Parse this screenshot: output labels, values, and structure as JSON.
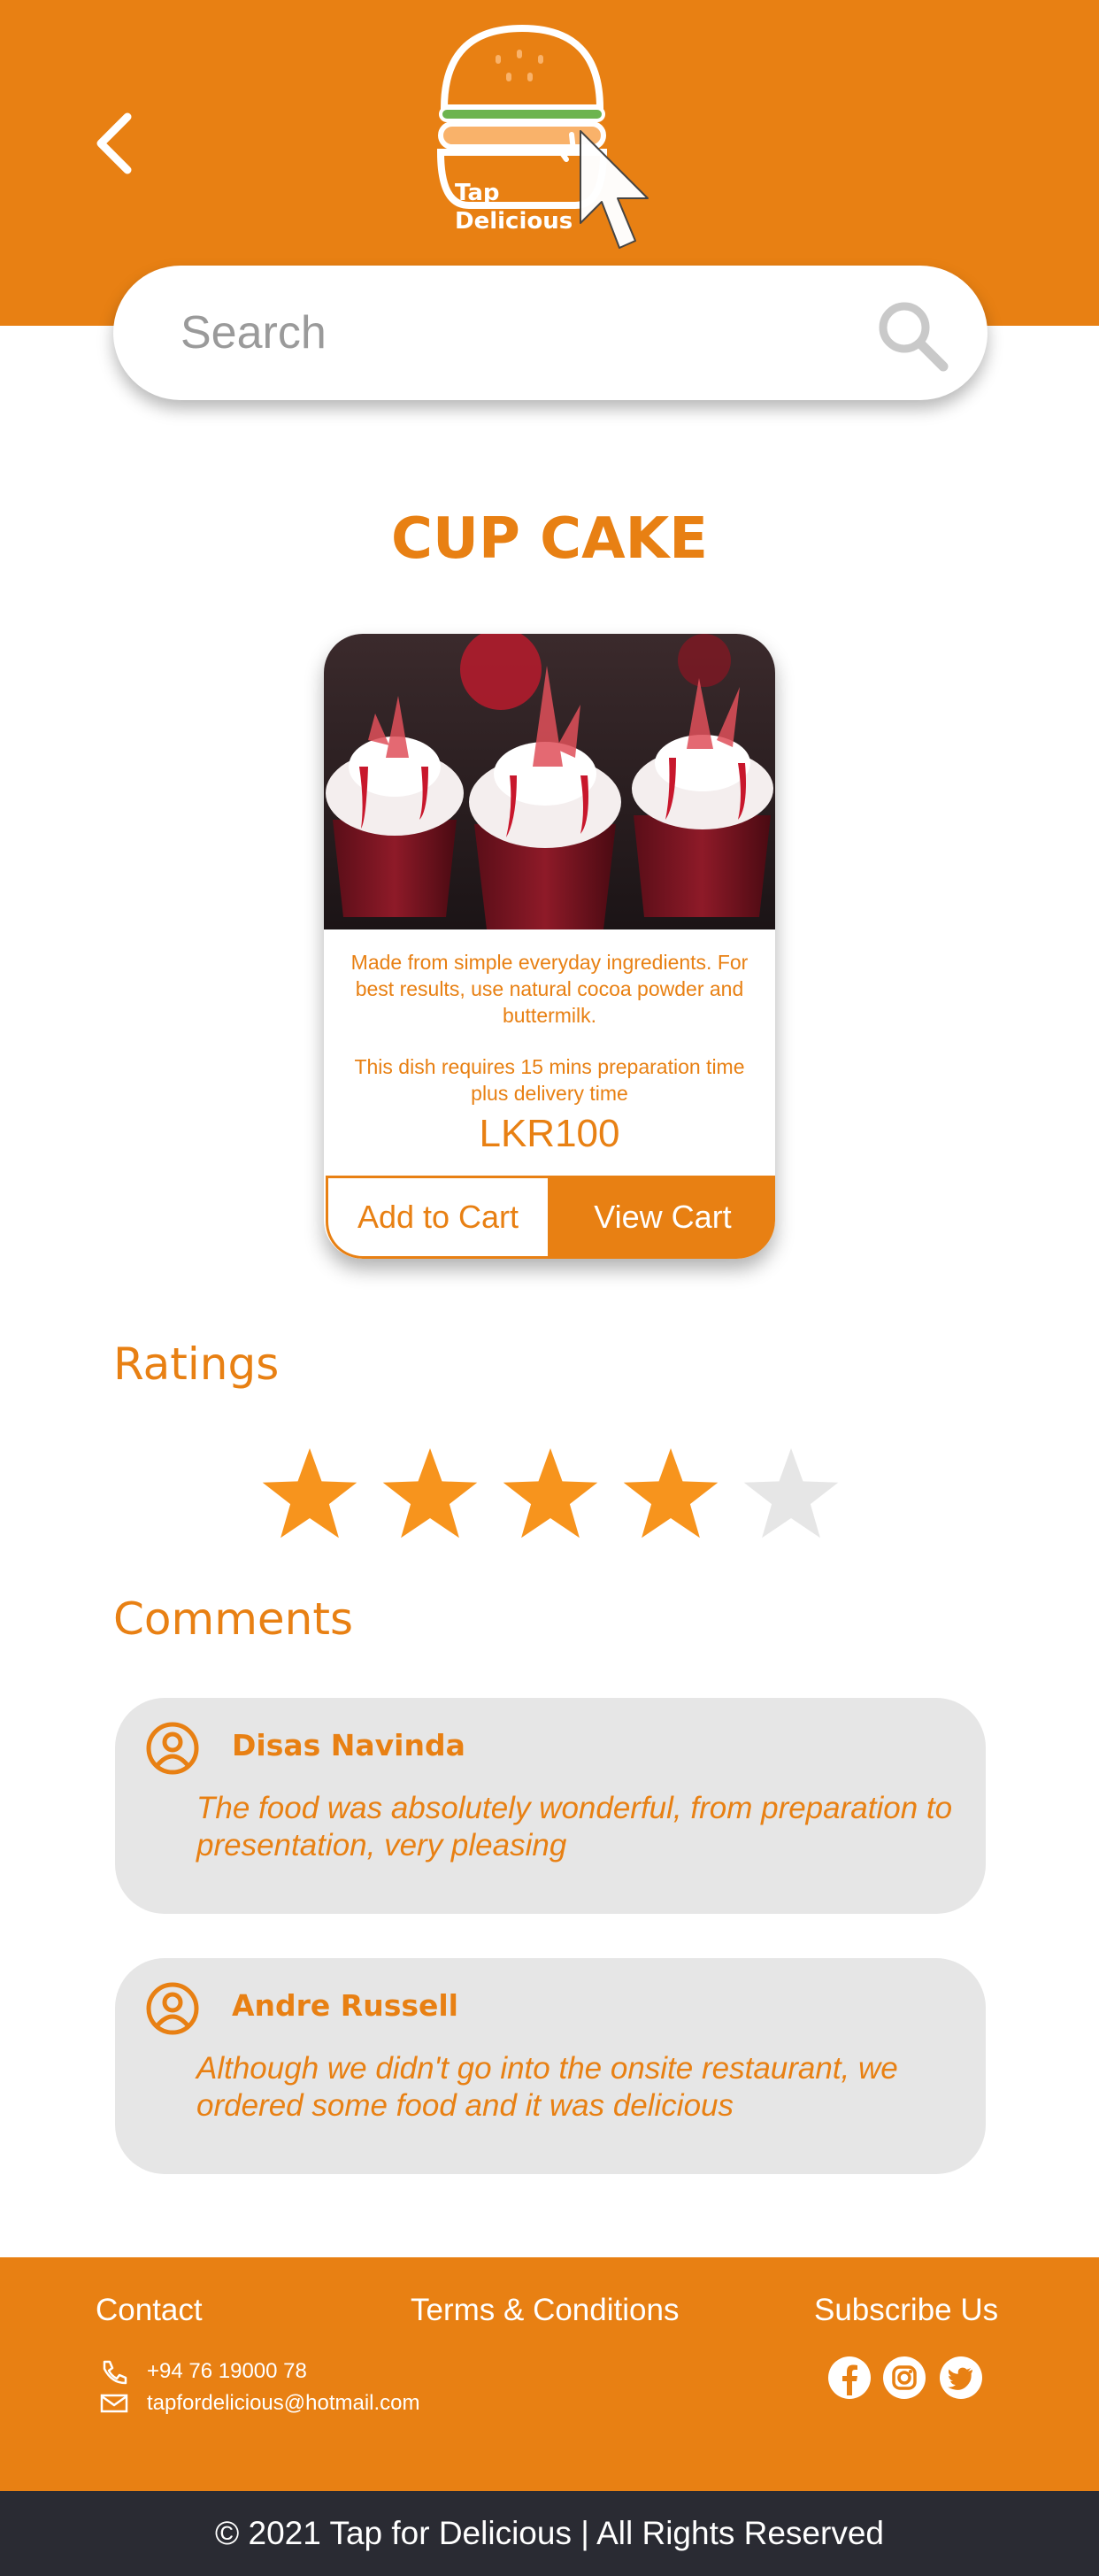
{
  "header": {
    "back_icon": "chevron-left-icon",
    "logo_text_line1": "Tap",
    "logo_text_line2": "Delicious"
  },
  "search": {
    "placeholder": "Search",
    "icon": "search-icon"
  },
  "product": {
    "title": "CUP CAKE",
    "description": "Made from simple everyday ingredients. For best results, use natural cocoa powder and buttermilk.",
    "prep_time": "This dish requires 15 mins preparation time plus delivery time",
    "price": "LKR100",
    "add_to_cart_label": "Add to Cart",
    "view_cart_label": "View Cart"
  },
  "ratings": {
    "title": "Ratings",
    "value": 4,
    "max": 5
  },
  "comments": {
    "title": "Comments",
    "items": [
      {
        "author": "Disas Navinda",
        "text": "The food was absolutely wonderful, from preparation to presentation, very pleasing"
      },
      {
        "author": "Andre Russell",
        "text": "Although we didn't go into the onsite restaurant, we ordered some food and it was delicious"
      }
    ]
  },
  "footer": {
    "contact_title": "Contact",
    "phone": "+94 76 19000 78",
    "email": "tapfordelicious@hotmail.com",
    "terms_label": "Terms & Conditions",
    "subscribe_title": "Subscribe Us",
    "social_icons": [
      "facebook-icon",
      "instagram-icon",
      "twitter-icon"
    ],
    "copyright": "© 2021 Tap for Delicious | All Rights Reserved"
  },
  "colors": {
    "brand": "#E88013",
    "star_filled": "#F7941D",
    "star_empty": "#E6E6E6",
    "footer_bar": "#2A2B33"
  }
}
